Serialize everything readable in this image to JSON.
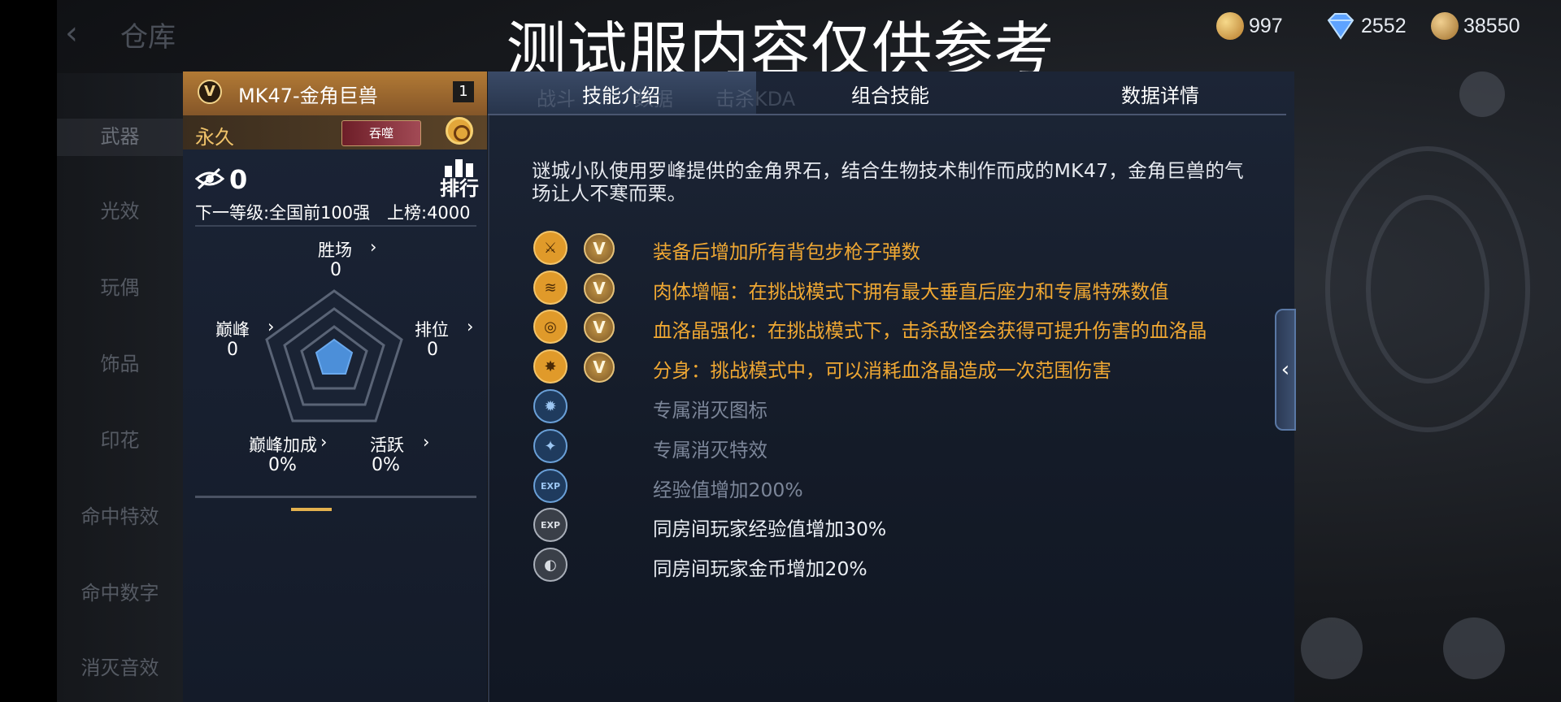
{
  "topbar": {
    "back_icon": "‹",
    "title": "仓库"
  },
  "watermark": "测试服内容仅供参考",
  "currency": [
    {
      "name": "gold-coupon",
      "value": "997",
      "color": "#d9a54a"
    },
    {
      "name": "diamond",
      "value": "2552",
      "color": "#6aa7ff"
    },
    {
      "name": "gold-coin",
      "value": "38550",
      "color": "#c9953e"
    }
  ],
  "left_nav": [
    "武器",
    "光效",
    "玩偶",
    "饰品",
    "印花",
    "命中特效",
    "命中数字",
    "消灭音效"
  ],
  "card": {
    "weapon_name": "MK47-金角巨兽",
    "slot_number": "1",
    "duration": "永久",
    "tag": "吞噬",
    "kill_count": "0",
    "rank_label": "排行",
    "next_level": "下一等级:全国前100强",
    "leaderboard": "上榜:4000",
    "stats": [
      {
        "label": "胜场",
        "value": "0"
      },
      {
        "label": "巅峰",
        "value": "0"
      },
      {
        "label": "排位",
        "value": "0"
      },
      {
        "label": "巅峰加成",
        "value": "0%"
      },
      {
        "label": "活跃",
        "value": "0%"
      }
    ],
    "arrow": "›"
  },
  "tabs": [
    "技能介绍",
    "组合技能",
    "数据详情"
  ],
  "ghost_tabs": [
    "战斗",
    "数据",
    "击杀KDA"
  ],
  "description": "谜城小队使用罗峰提供的金角界石，结合生物技术制作而成的MK47，金角巨兽的气场让人不寒而栗。",
  "skills": [
    {
      "text": "装备后增加所有背包步枪子弹数",
      "style": "gold",
      "icon": "rifle-icon",
      "glyph": "⚔",
      "badge": "V"
    },
    {
      "text": "肉体增幅：在挑战模式下拥有最大垂直后座力和专属特殊数值",
      "style": "gold",
      "icon": "claw-icon",
      "glyph": "≋",
      "badge": "V"
    },
    {
      "text": "血洛晶强化：在挑战模式下，击杀敌怪会获得可提升伤害的血洛晶",
      "style": "gold",
      "icon": "crosshair-icon",
      "glyph": "◎",
      "badge": "V"
    },
    {
      "text": "分身：挑战模式中，可以消耗血洛晶造成一次范围伤害",
      "style": "gold",
      "icon": "burst-icon",
      "glyph": "✸",
      "badge": "V"
    },
    {
      "text": "专属消灭图标",
      "style": "grey",
      "icon": "kill-icon-icon",
      "glyph": "✹",
      "badge": ""
    },
    {
      "text": "专属消灭特效",
      "style": "grey",
      "icon": "kill-effect-icon",
      "glyph": "✦",
      "badge": ""
    },
    {
      "text": "经验值增加200%",
      "style": "grey",
      "icon": "exp-icon",
      "glyph": "EXP",
      "badge": ""
    },
    {
      "text": "同房间玩家经验值增加30%",
      "style": "white",
      "icon": "room-exp-icon",
      "glyph": "EXP",
      "badge": ""
    },
    {
      "text": "同房间玩家金币增加20%",
      "style": "white",
      "icon": "room-coin-icon",
      "glyph": "◐",
      "badge": ""
    }
  ],
  "side_handle": "‹"
}
